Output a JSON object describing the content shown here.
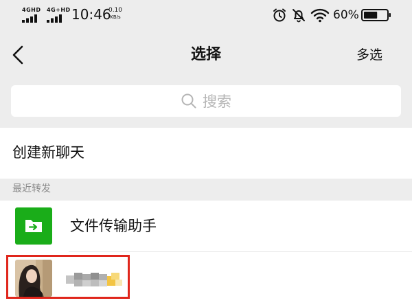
{
  "status_bar": {
    "net_1": "4GHD",
    "net_2": "4G+HD",
    "time": "10:46",
    "speed_value": "0.10",
    "speed_unit": "KB/s",
    "battery_percent": "60%",
    "battery_level": 0.6,
    "icons": [
      "signal-icon",
      "alarm-icon",
      "mute-bell-icon",
      "wifi-icon",
      "battery-icon"
    ]
  },
  "nav": {
    "title": "选择",
    "multi_select_label": "多选",
    "back_icon": "chevron-left-icon"
  },
  "search": {
    "placeholder": "搜索",
    "icon": "search-icon"
  },
  "new_chat_label": "创建新聊天",
  "recent": {
    "section_label": "最近转发",
    "items": [
      {
        "label": "文件传输助手",
        "avatar": "file-transfer-icon"
      },
      {
        "label": "",
        "avatar": "contact-photo"
      }
    ]
  },
  "colors": {
    "background": "#ededed",
    "file_transfer_green": "#1aad19",
    "highlight_red": "#e0261c"
  }
}
